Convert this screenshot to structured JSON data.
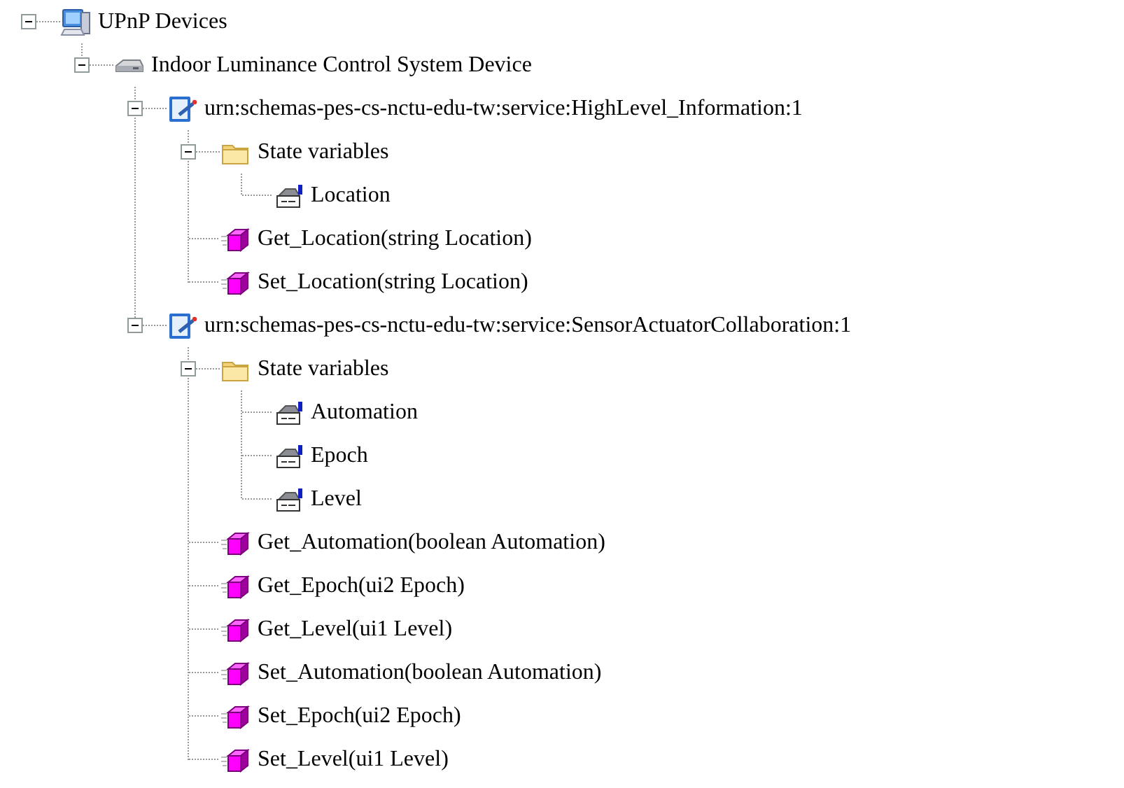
{
  "tree": [
    {
      "kind": "root",
      "label": "UPnP Devices",
      "expanded": true,
      "children": [
        {
          "kind": "device",
          "label": "Indoor Luminance Control System Device",
          "expanded": true,
          "children": [
            {
              "kind": "service",
              "label": "urn:schemas-pes-cs-nctu-edu-tw:service:HighLevel_Information:1",
              "expanded": true,
              "children": [
                {
                  "kind": "folder",
                  "label": "State variables",
                  "expanded": true,
                  "children": [
                    {
                      "kind": "variable",
                      "label": "Location"
                    }
                  ]
                },
                {
                  "kind": "action",
                  "label": "Get_Location(string Location)"
                },
                {
                  "kind": "action",
                  "label": "Set_Location(string Location)"
                }
              ]
            },
            {
              "kind": "service",
              "label": "urn:schemas-pes-cs-nctu-edu-tw:service:SensorActuatorCollaboration:1",
              "expanded": true,
              "children": [
                {
                  "kind": "folder",
                  "label": "State variables",
                  "expanded": true,
                  "children": [
                    {
                      "kind": "variable",
                      "label": "Automation"
                    },
                    {
                      "kind": "variable",
                      "label": "Epoch"
                    },
                    {
                      "kind": "variable",
                      "label": "Level"
                    }
                  ]
                },
                {
                  "kind": "action",
                  "label": "Get_Automation(boolean Automation)"
                },
                {
                  "kind": "action",
                  "label": "Get_Epoch(ui2 Epoch)"
                },
                {
                  "kind": "action",
                  "label": "Get_Level(ui1 Level)"
                },
                {
                  "kind": "action",
                  "label": "Set_Automation(boolean Automation)"
                },
                {
                  "kind": "action",
                  "label": "Set_Epoch(ui2 Epoch)"
                },
                {
                  "kind": "action",
                  "label": "Set_Level(ui1 Level)"
                }
              ]
            }
          ]
        }
      ]
    }
  ]
}
